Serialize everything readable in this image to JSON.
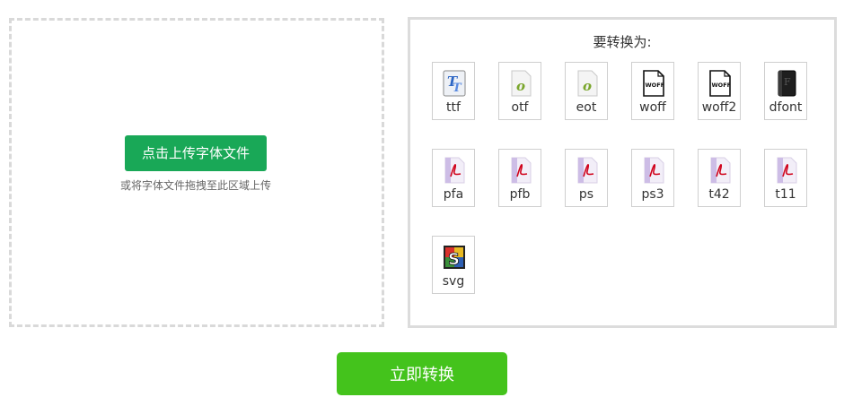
{
  "upload": {
    "button_label": "点击上传字体文件",
    "hint": "或将字体文件拖拽至此区域上传"
  },
  "formats": {
    "title": "要转换为:",
    "items": [
      {
        "label": "ttf",
        "icon": "ttf-icon"
      },
      {
        "label": "otf",
        "icon": "otf-icon"
      },
      {
        "label": "eot",
        "icon": "eot-icon"
      },
      {
        "label": "woff",
        "icon": "woff-icon"
      },
      {
        "label": "woff2",
        "icon": "woff2-icon"
      },
      {
        "label": "dfont",
        "icon": "dfont-icon"
      },
      {
        "label": "pfa",
        "icon": "pdf-icon"
      },
      {
        "label": "pfb",
        "icon": "pdf-icon"
      },
      {
        "label": "ps",
        "icon": "pdf-icon"
      },
      {
        "label": "ps3",
        "icon": "pdf-icon"
      },
      {
        "label": "t42",
        "icon": "pdf-icon"
      },
      {
        "label": "t11",
        "icon": "pdf-icon"
      },
      {
        "label": "svg",
        "icon": "svg-icon"
      }
    ]
  },
  "convert": {
    "button_label": "立即转换"
  },
  "colors": {
    "upload_button": "#19a857",
    "convert_button": "#44c31c"
  }
}
